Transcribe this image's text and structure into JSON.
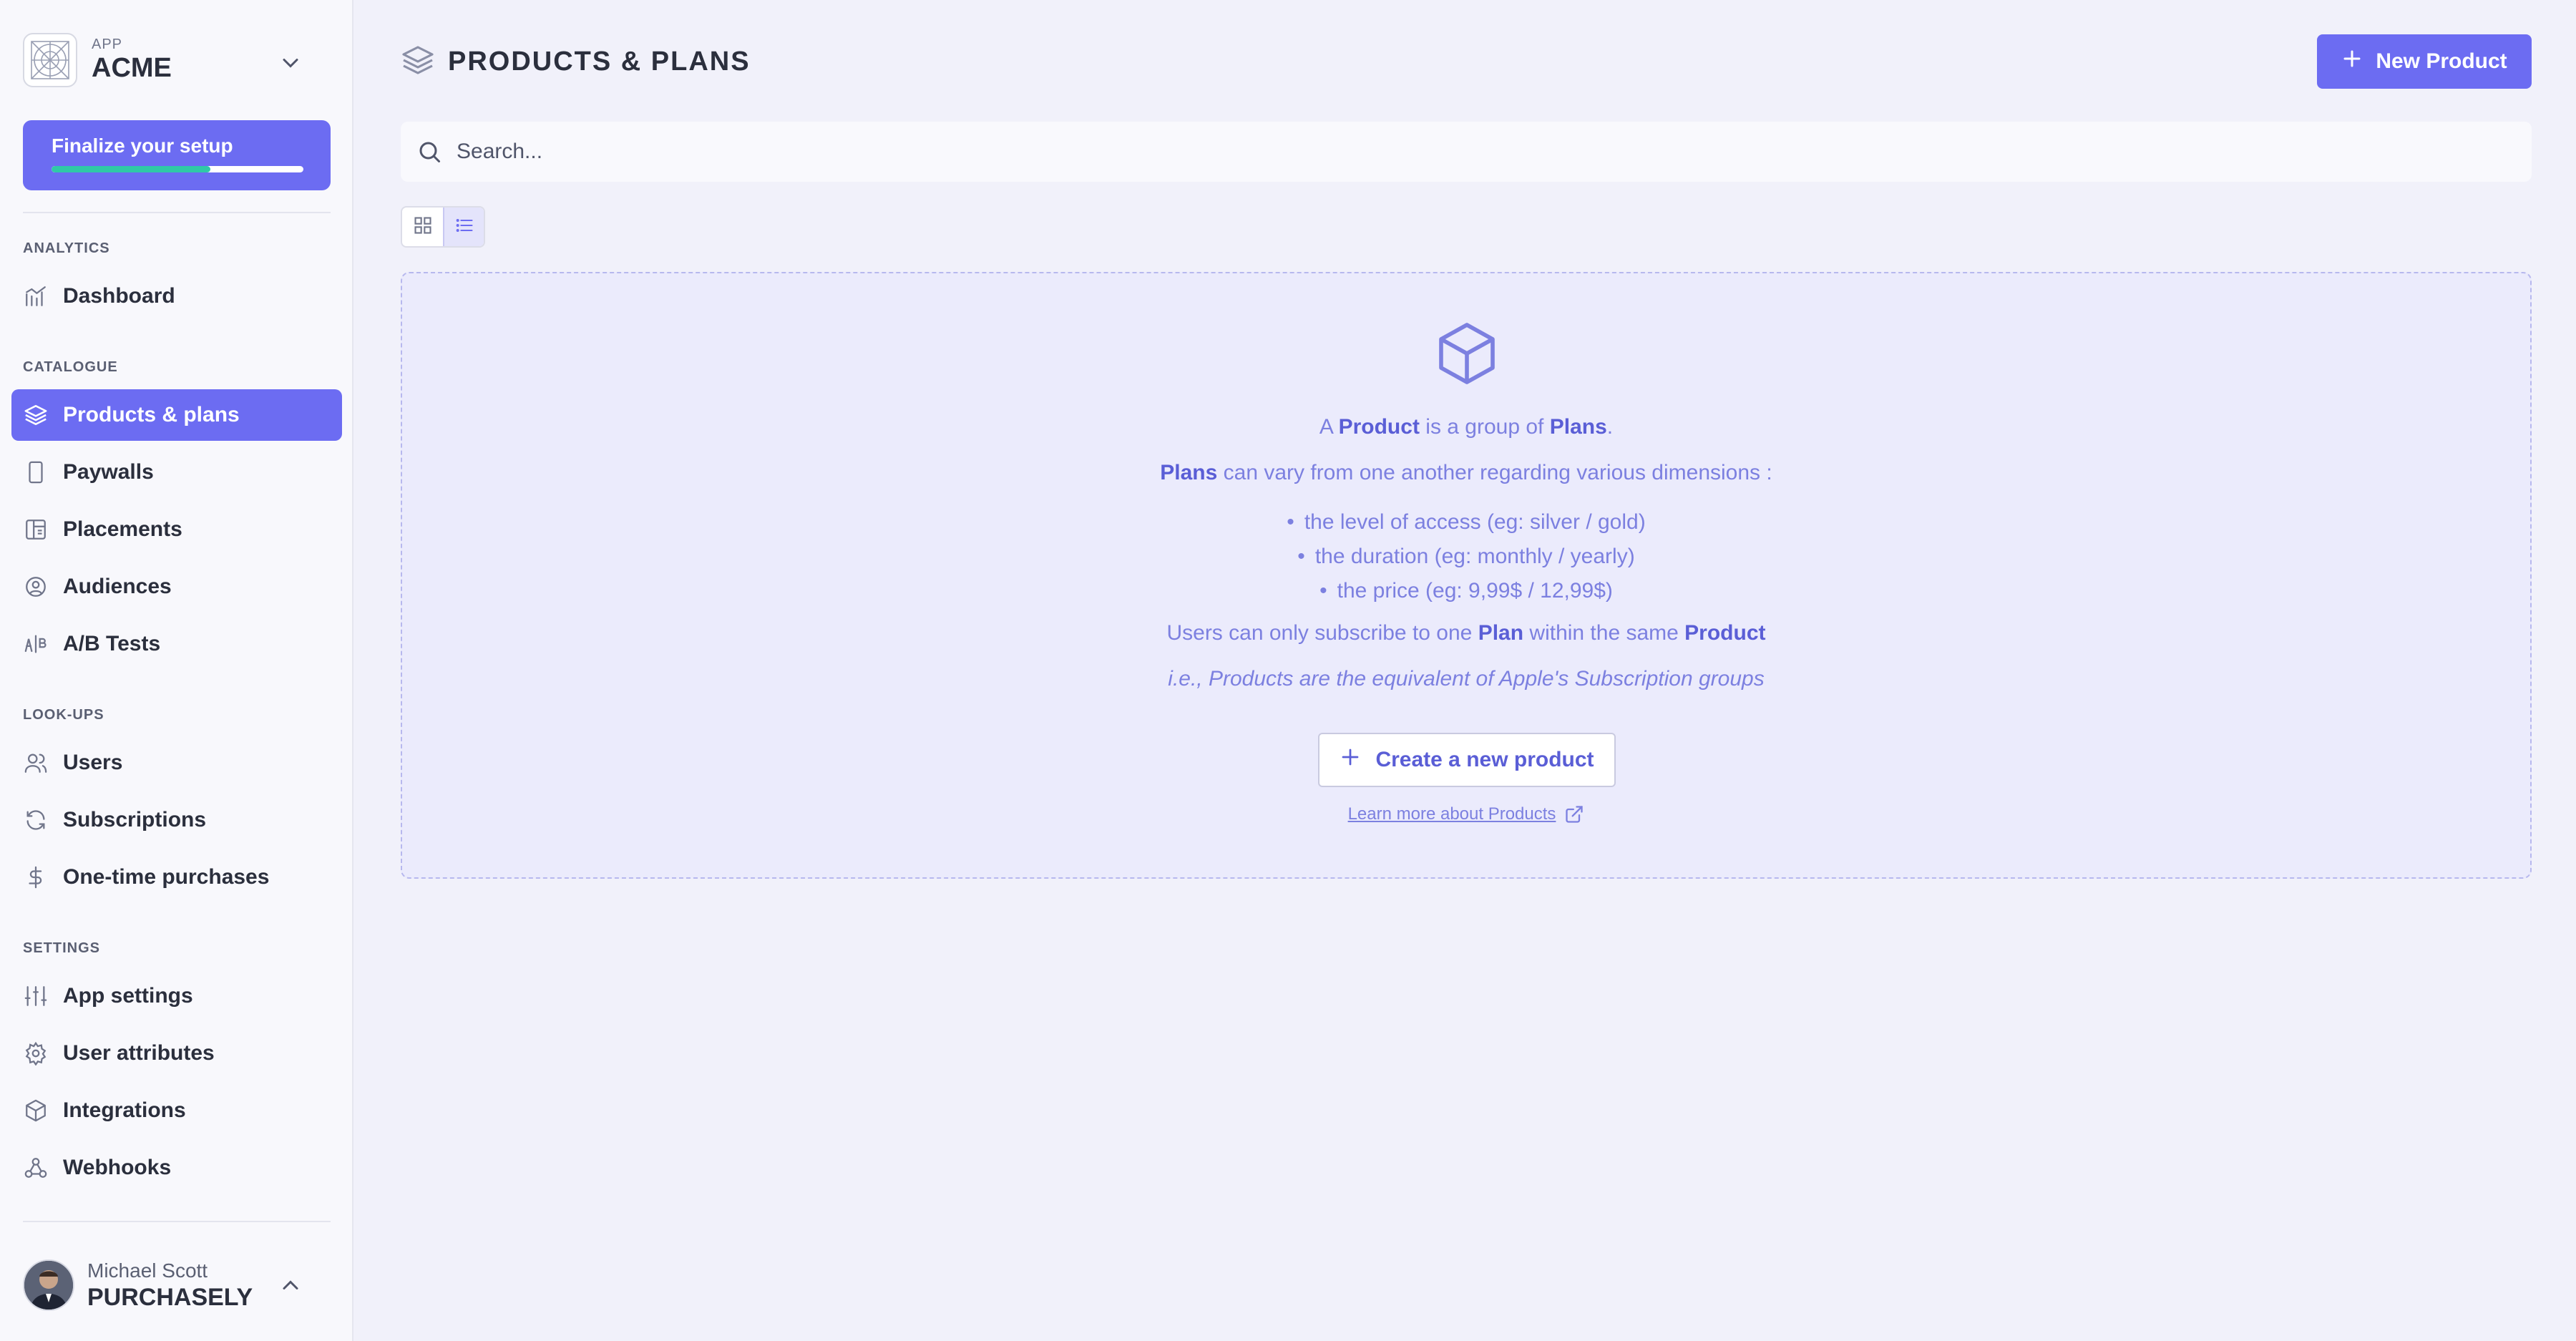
{
  "app": {
    "kicker": "APP",
    "name": "ACME"
  },
  "setup": {
    "label": "Finalize your setup",
    "progress": 0.63
  },
  "sections": {
    "analytics": "ANALYTICS",
    "catalogue": "CATALOGUE",
    "lookups": "LOOK-UPS",
    "settings": "SETTINGS"
  },
  "nav": {
    "dashboard": "Dashboard",
    "products": "Products & plans",
    "paywalls": "Paywalls",
    "placements": "Placements",
    "audiences": "Audiences",
    "abtests": "A/B Tests",
    "users": "Users",
    "subscriptions": "Subscriptions",
    "onetime": "One-time purchases",
    "appsettings": "App settings",
    "userattributes": "User attributes",
    "integrations": "Integrations",
    "webhooks": "Webhooks"
  },
  "user": {
    "name": "Michael Scott",
    "org": "PURCHASELY"
  },
  "header": {
    "title": "PRODUCTS & PLANS",
    "new_button": "New Product"
  },
  "search": {
    "placeholder": "Search..."
  },
  "empty": {
    "l1_a": "A ",
    "l1_product": "Product",
    "l1_b": " is a group of ",
    "l1_plans": "Plans",
    "l1_c": ".",
    "l2_plans": "Plans",
    "l2_rest": " can vary from one another regarding various dimensions :",
    "bullets": [
      "the level of access (eg: silver / gold)",
      "the duration (eg: monthly / yearly)",
      "the price (eg: 9,99$ / 12,99$)"
    ],
    "l3_a": "Users can only subscribe to one ",
    "l3_plan": "Plan",
    "l3_b": " within the same ",
    "l3_product": "Product",
    "l4": "i.e., Products are the equivalent of Apple's Subscription groups",
    "create_button": "Create a new product",
    "learn_link": "Learn more about Products"
  },
  "colors": {
    "accent": "#6c6cf2",
    "progress": "#2fc9a7"
  }
}
